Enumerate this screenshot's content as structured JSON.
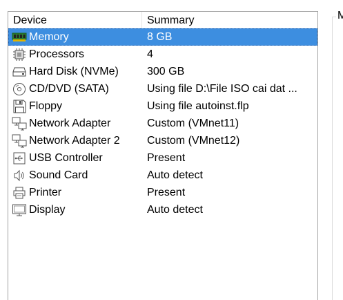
{
  "table": {
    "headers": {
      "device": "Device",
      "summary": "Summary"
    },
    "rows": [
      {
        "device": "Memory",
        "summary": "8 GB",
        "icon": "memory-icon",
        "selected": true
      },
      {
        "device": "Processors",
        "summary": "4",
        "icon": "processor-icon",
        "selected": false
      },
      {
        "device": "Hard Disk (NVMe)",
        "summary": "300 GB",
        "icon": "hard-disk-icon",
        "selected": false
      },
      {
        "device": "CD/DVD (SATA)",
        "summary": "Using file D:\\File ISO cai dat ...",
        "icon": "cd-dvd-icon",
        "selected": false
      },
      {
        "device": "Floppy",
        "summary": "Using file autoinst.flp",
        "icon": "floppy-icon",
        "selected": false
      },
      {
        "device": "Network Adapter",
        "summary": "Custom (VMnet11)",
        "icon": "network-adapter-icon",
        "selected": false
      },
      {
        "device": "Network Adapter 2",
        "summary": "Custom (VMnet12)",
        "icon": "network-adapter-icon",
        "selected": false
      },
      {
        "device": "USB Controller",
        "summary": "Present",
        "icon": "usb-icon",
        "selected": false
      },
      {
        "device": "Sound Card",
        "summary": "Auto detect",
        "icon": "speaker-icon",
        "selected": false
      },
      {
        "device": "Printer",
        "summary": "Present",
        "icon": "printer-icon",
        "selected": false
      },
      {
        "device": "Display",
        "summary": "Auto detect",
        "icon": "monitor-icon",
        "selected": false
      }
    ]
  },
  "right_panel": {
    "caption": "M"
  },
  "colors": {
    "selection": "#3d8ee0",
    "border": "#a0a0a0"
  }
}
